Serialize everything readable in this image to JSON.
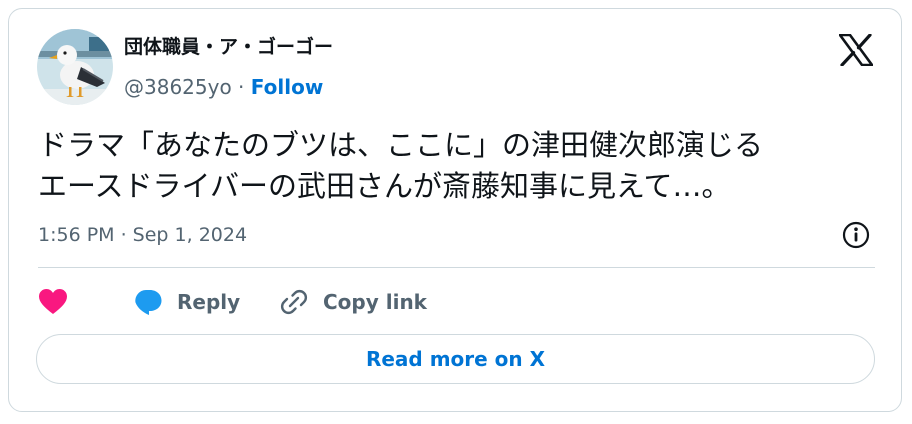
{
  "author": {
    "display_name": "団体職員・ア・ゴーゴー",
    "handle": "@38625yo",
    "separator": " · ",
    "follow_label": "Follow"
  },
  "tweet": {
    "lines": [
      "ドラマ「あなたのブツは、ここに」の津田健次郎演じる",
      "エースドライバーの武田さんが斎藤知事に見えて…。"
    ],
    "timestamp": "1:56 PM · Sep 1, 2024"
  },
  "actions": {
    "like_icon": "heart-icon",
    "reply_label": "Reply",
    "copy_link_label": "Copy link"
  },
  "read_more_label": "Read more on X",
  "icons": {
    "brand": "x-logo-icon",
    "info": "info-icon",
    "reply": "speech-bubble-icon",
    "copy": "link-icon"
  },
  "colors": {
    "link_blue": "#0074d4",
    "like_pink": "#f91880",
    "reply_blue": "#1d9bf0",
    "muted_text": "#536471",
    "border": "#cfd9de",
    "text": "#0f1419"
  }
}
